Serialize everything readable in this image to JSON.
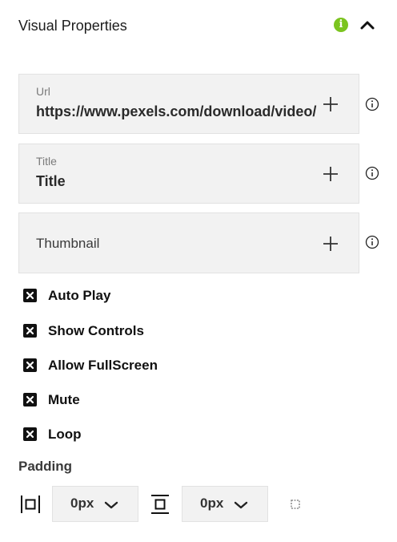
{
  "header": {
    "title": "Visual Properties",
    "info_icon": "info-icon",
    "collapse_icon": "chevron-up-icon",
    "accent": "#7bc41f"
  },
  "fields": {
    "url": {
      "label": "Url",
      "value": "https://www.pexels.com/download/video/"
    },
    "title": {
      "label": "Title",
      "value": "Title"
    },
    "thumbnail": {
      "placeholder": "Thumbnail"
    }
  },
  "options": [
    {
      "label": "Auto Play"
    },
    {
      "label": "Show Controls"
    },
    {
      "label": "Allow FullScreen"
    },
    {
      "label": "Mute"
    },
    {
      "label": "Loop"
    }
  ],
  "padding": {
    "label": "Padding",
    "horizontal": "0px",
    "vertical": "0px"
  }
}
